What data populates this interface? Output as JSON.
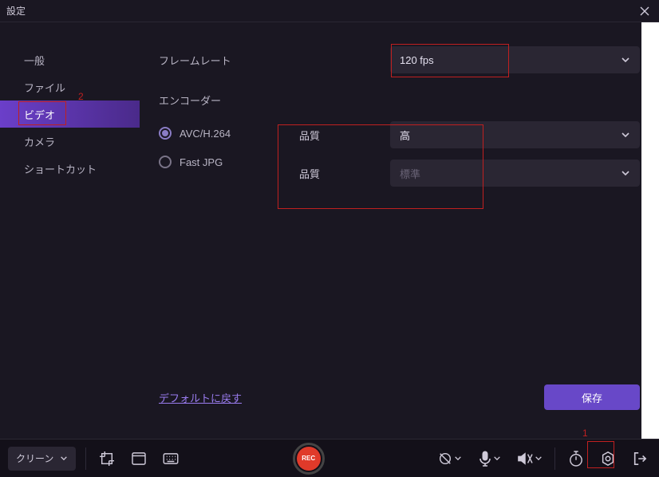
{
  "window": {
    "title": "設定"
  },
  "sidebar": {
    "items": [
      {
        "label": "一般"
      },
      {
        "label": "ファイル"
      },
      {
        "label": "ビデオ"
      },
      {
        "label": "カメラ"
      },
      {
        "label": "ショートカット"
      }
    ],
    "activeIndex": 2
  },
  "content": {
    "framerate_label": "フレームレート",
    "framerate_value": "120 fps",
    "encoder_label": "エンコーダー",
    "encoder_options": [
      {
        "label": "AVC/H.264",
        "selected": true
      },
      {
        "label": "Fast JPG",
        "selected": false
      }
    ],
    "quality1_label": "品質",
    "quality1_value": "高",
    "quality2_label": "品質",
    "quality2_value": "標準"
  },
  "actions": {
    "reset_label": "デフォルトに戻す",
    "save_label": "保存"
  },
  "toolbar": {
    "source": "クリーン",
    "rec_label": "REC"
  },
  "annotations": {
    "num1": "1",
    "num2": "2"
  }
}
